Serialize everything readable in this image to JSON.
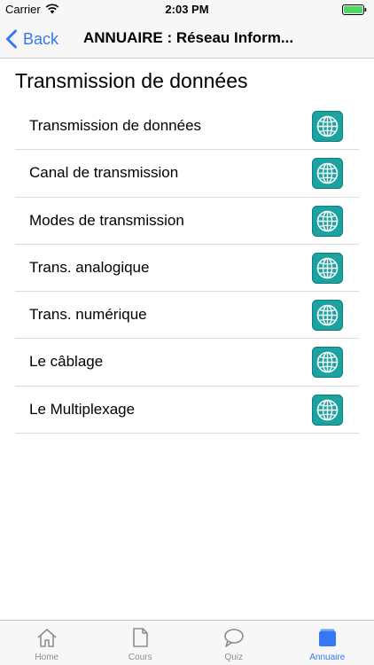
{
  "status_bar": {
    "carrier": "Carrier",
    "time": "2:03 PM"
  },
  "nav": {
    "back_label": "Back",
    "title": "ANNUAIRE : Réseau Inform..."
  },
  "section": {
    "title": "Transmission de données"
  },
  "list": {
    "items": [
      {
        "label": "Transmission de données",
        "icon": "globe-icon"
      },
      {
        "label": "Canal de transmission",
        "icon": "globe-icon"
      },
      {
        "label": "Modes de transmission",
        "icon": "globe-icon"
      },
      {
        "label": "Trans. analogique",
        "icon": "globe-icon"
      },
      {
        "label": "Trans. numérique",
        "icon": "globe-icon"
      },
      {
        "label": "Le câblage",
        "icon": "globe-icon"
      },
      {
        "label": "Le Multiplexage",
        "icon": "globe-icon"
      }
    ]
  },
  "tabs": [
    {
      "label": "Home",
      "icon": "home-icon"
    },
    {
      "label": "Cours",
      "icon": "document-icon"
    },
    {
      "label": "Quiz",
      "icon": "chat-bubble-icon"
    },
    {
      "label": "Annuaire",
      "icon": "book-icon",
      "active": true
    }
  ],
  "colors": {
    "accent": "#3478f6",
    "globe": "#1aa3a0",
    "battery": "#4cd964"
  }
}
